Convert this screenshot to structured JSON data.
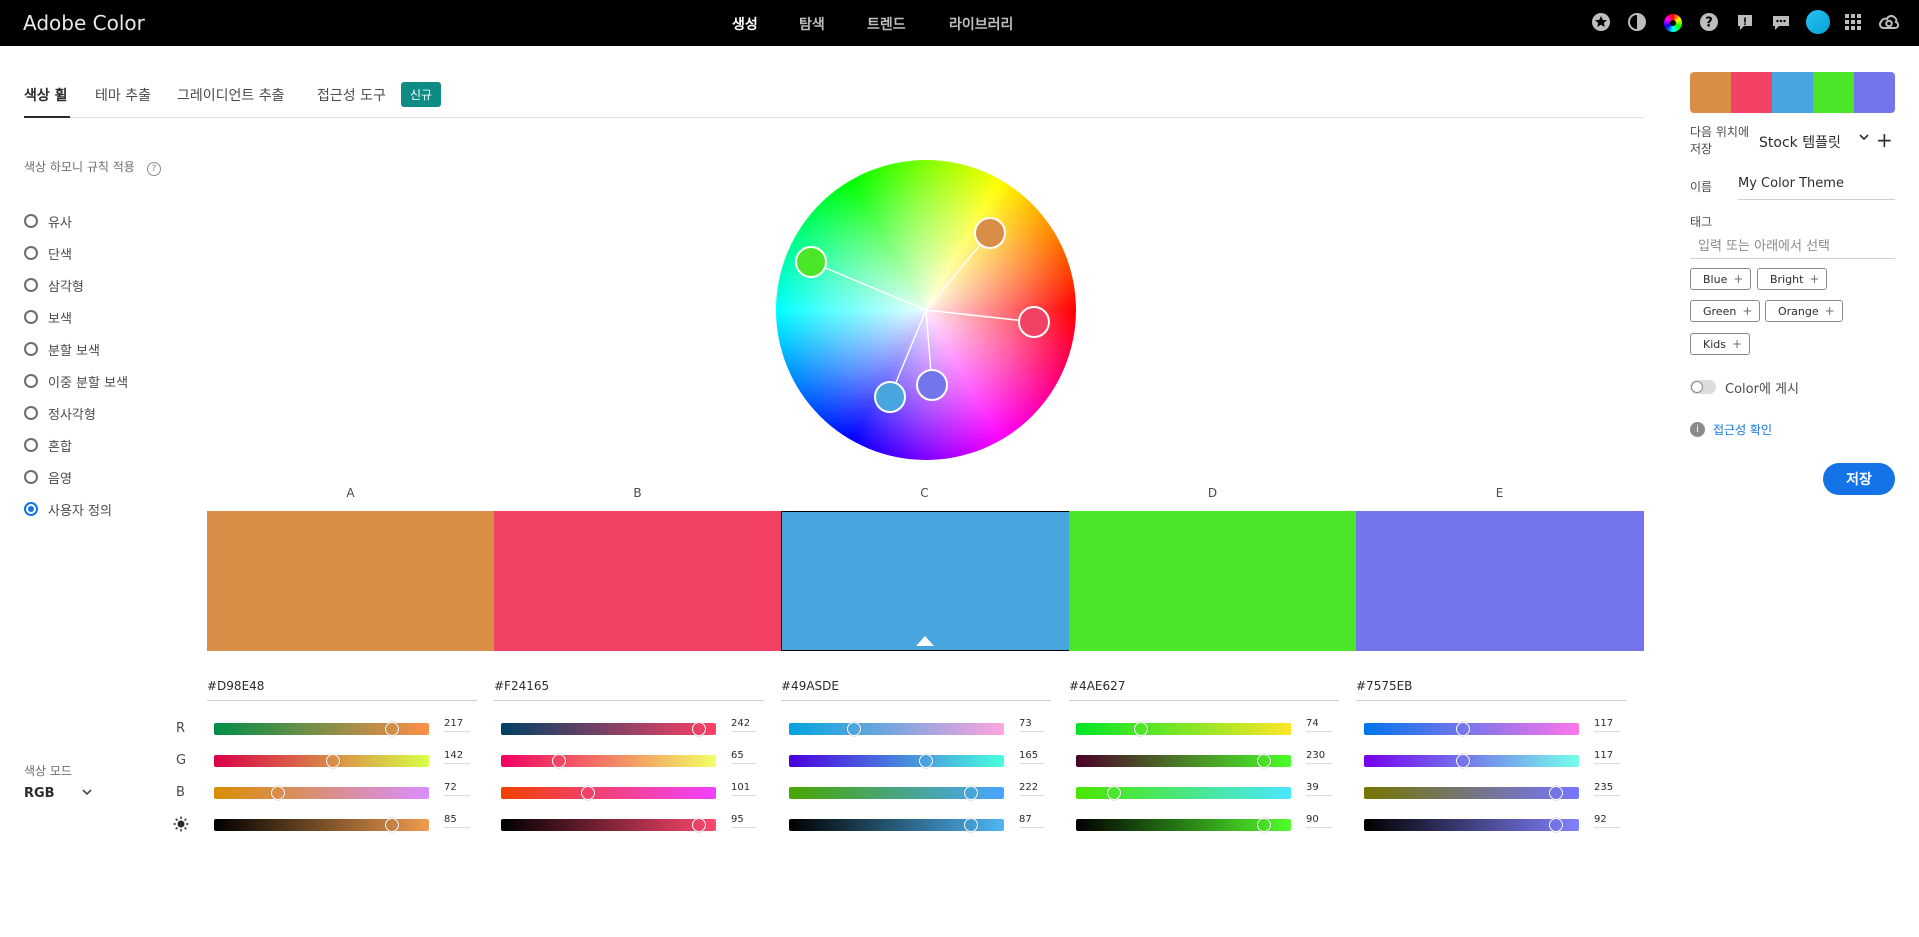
{
  "app": {
    "title": "Adobe Color"
  },
  "topnav": [
    {
      "label": "생성",
      "active": true
    },
    {
      "label": "탐색",
      "active": false
    },
    {
      "label": "트렌드",
      "active": false
    },
    {
      "label": "라이브러리",
      "active": false
    }
  ],
  "top_icons": [
    "star-icon",
    "contrast-icon",
    "color-wheel-icon",
    "help-icon",
    "feedback-icon",
    "chat-icon",
    "avatar",
    "apps-grid-icon",
    "creative-cloud-icon"
  ],
  "tabs": [
    {
      "label": "색상 휠",
      "active": true
    },
    {
      "label": "테마 추출",
      "active": false
    },
    {
      "label": "그레이디언트 추출",
      "active": false
    },
    {
      "label": "접근성 도구",
      "active": false
    }
  ],
  "new_badge": "신규",
  "harmony": {
    "label": "색상 하모니 규칙 적용",
    "rules": [
      {
        "label": "유사",
        "selected": false
      },
      {
        "label": "단색",
        "selected": false
      },
      {
        "label": "삼각형",
        "selected": false
      },
      {
        "label": "보색",
        "selected": false
      },
      {
        "label": "분할 보색",
        "selected": false
      },
      {
        "label": "이중 분할 보색",
        "selected": false
      },
      {
        "label": "정사각형",
        "selected": false
      },
      {
        "label": "혼합",
        "selected": false
      },
      {
        "label": "음영",
        "selected": false
      },
      {
        "label": "사용자 정의",
        "selected": true
      }
    ]
  },
  "swatches": [
    {
      "letter": "A",
      "hex": "#D98E48",
      "color": "#D98E48",
      "selected": false,
      "rgb": [
        217,
        142,
        72
      ],
      "brightness": 85
    },
    {
      "letter": "B",
      "hex": "#F24165",
      "color": "#F24165",
      "selected": false,
      "rgb": [
        242,
        65,
        101
      ],
      "brightness": 95
    },
    {
      "letter": "C",
      "hex": "#49ASDE",
      "color": "#49A5DE",
      "selected": true,
      "rgb": [
        73,
        165,
        222
      ],
      "brightness": 87
    },
    {
      "letter": "D",
      "hex": "#4AE627",
      "color": "#4AE627",
      "selected": false,
      "rgb": [
        74,
        230,
        39
      ],
      "brightness": 90
    },
    {
      "letter": "E",
      "hex": "#7575EB",
      "color": "#7575EB",
      "selected": false,
      "rgb": [
        117,
        117,
        235
      ],
      "brightness": 92
    }
  ],
  "channel_labels": {
    "r": "R",
    "g": "G",
    "b": "B",
    "brightness_icon": "sun-icon"
  },
  "color_mode": {
    "label": "색상 모드",
    "value": "RGB"
  },
  "right_panel": {
    "save_to_label": "다음 위치에 저장",
    "save_to_value": "Stock 템플릿",
    "name_label": "이름",
    "name_value": "My Color Theme",
    "tag_label": "태그",
    "tag_placeholder": "입력 또는 아래에서 선택",
    "tags": [
      "Blue",
      "Bright",
      "Green",
      "Orange",
      "Kids"
    ],
    "publish_label": "Color에 게시",
    "accessibility_link": "접근성 확인",
    "save_button": "저장"
  }
}
